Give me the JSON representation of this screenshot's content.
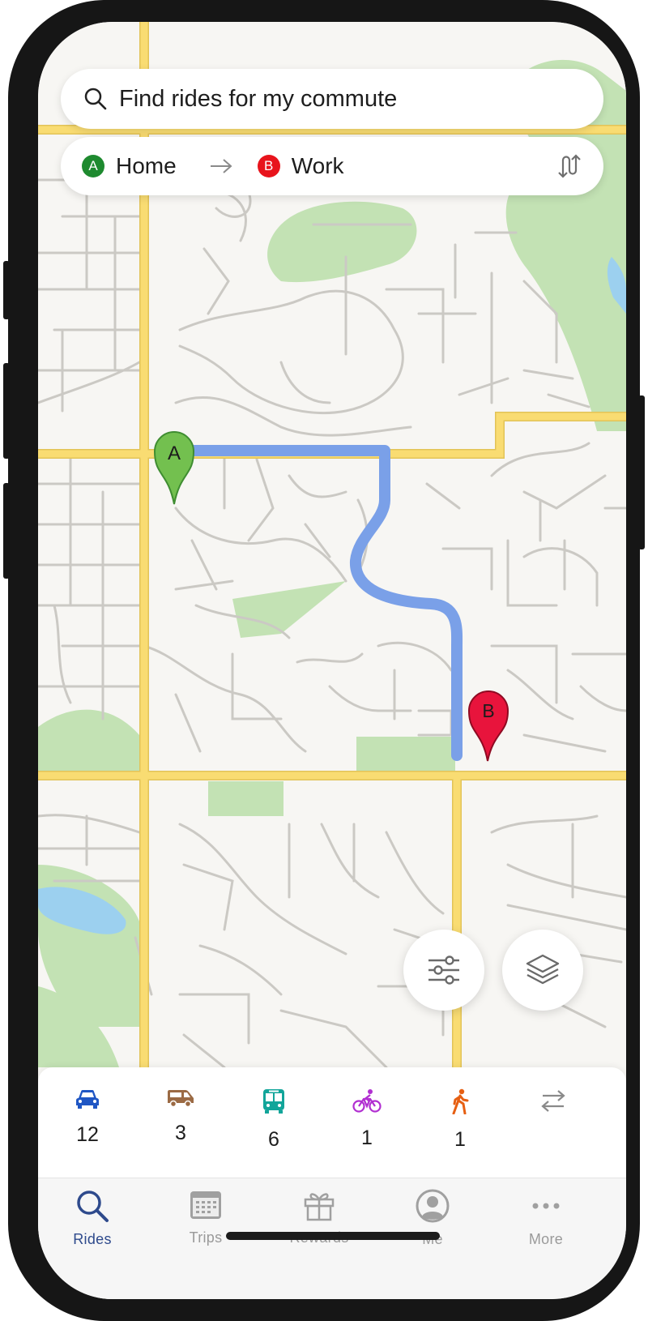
{
  "search": {
    "placeholder": "Find rides for my commute",
    "icon": "search-icon"
  },
  "route": {
    "origin": {
      "badge": "A",
      "label": "Home",
      "color": "#1e8a2f"
    },
    "destination": {
      "badge": "B",
      "label": "Work",
      "color": "#e8141c"
    },
    "arrow_icon": "arrow-right-icon",
    "swap_icon": "swap-route-icon"
  },
  "map": {
    "pin_a": {
      "label": "A",
      "color": "#73c04f"
    },
    "pin_b": {
      "label": "B",
      "color": "#e8143c"
    },
    "route_color": "#7aa0e8",
    "filter_icon": "sliders-icon",
    "layers_icon": "layers-icon"
  },
  "modes": [
    {
      "icon": "car-icon",
      "count": "12",
      "color": "#1f56c4"
    },
    {
      "icon": "van-icon",
      "count": "3",
      "color": "#9b6a44"
    },
    {
      "icon": "bus-icon",
      "count": "6",
      "color": "#12a59a"
    },
    {
      "icon": "bike-icon",
      "count": "1",
      "color": "#b12fd1"
    },
    {
      "icon": "walk-icon",
      "count": "1",
      "color": "#e65f12"
    },
    {
      "icon": "swap-horizontal-icon",
      "count": "",
      "color": "#8a8a8a"
    }
  ],
  "tabs": [
    {
      "label": "Rides",
      "icon": "search-icon",
      "active": true
    },
    {
      "label": "Trips",
      "icon": "calendar-icon",
      "active": false
    },
    {
      "label": "Rewards",
      "icon": "gift-icon",
      "active": false
    },
    {
      "label": "Me",
      "icon": "profile-icon",
      "active": false
    },
    {
      "label": "More",
      "icon": "more-dots-icon",
      "active": false
    }
  ],
  "colors": {
    "accent": "#2e4a8c",
    "major_road": "#f9dc72",
    "park": "#c3e2b4",
    "water": "#9cd0ef"
  }
}
